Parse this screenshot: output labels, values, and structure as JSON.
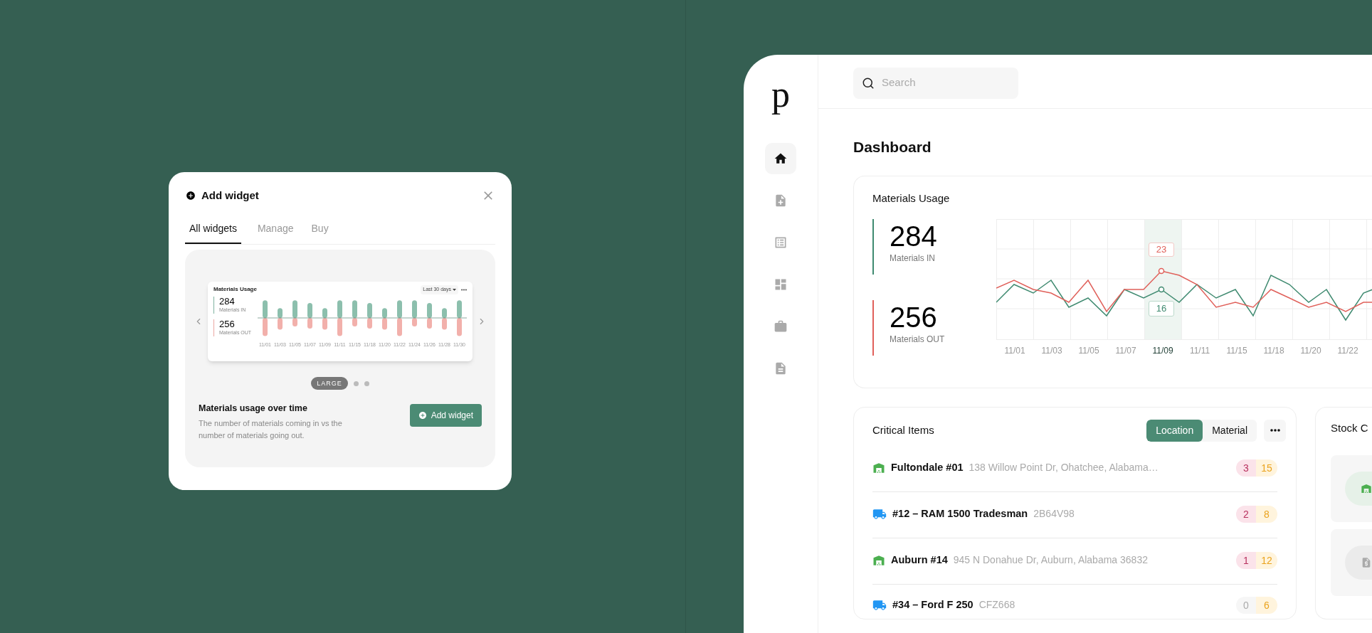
{
  "add_widget_dialog": {
    "title": "Add widget",
    "tabs": [
      {
        "label": "All widgets",
        "selected": true
      },
      {
        "label": "Manage",
        "selected": false
      },
      {
        "label": "Buy",
        "selected": false
      }
    ],
    "preview": {
      "title": "Materials Usage",
      "range": "Last 30 days",
      "stats": [
        {
          "value": "284",
          "label": "Materials IN",
          "color": "#7fb3a0"
        },
        {
          "value": "256",
          "label": "Materials OUT",
          "color": "#eaa7a2"
        }
      ],
      "x_labels": [
        "11/01",
        "11/03",
        "11/05",
        "11/07",
        "11/09",
        "11/11",
        "11/15",
        "11/18",
        "11/20",
        "11/22",
        "11/24",
        "11/26",
        "11/28",
        "11/30"
      ]
    },
    "sizes": [
      {
        "label": "LARGE",
        "selected": true
      },
      {
        "selected": false
      },
      {
        "selected": false
      }
    ],
    "widget_title": "Materials usage over time",
    "widget_description": "The number of materials coming in vs the number of materials going out.",
    "add_button": "Add widget"
  },
  "app": {
    "logo": "p",
    "sidebar": [
      {
        "selected": true
      },
      {
        "selected": false
      },
      {
        "selected": false
      },
      {
        "selected": false
      },
      {
        "selected": false
      },
      {
        "selected": false
      }
    ],
    "search": {
      "placeholder": "Search"
    },
    "page_title": "Dashboard",
    "materials_usage": {
      "title": "Materials Usage",
      "stats": [
        {
          "value": "284",
          "label": "Materials IN",
          "color": "#3f8a70"
        },
        {
          "value": "256",
          "label": "Materials OUT",
          "color": "#e0605a"
        }
      ],
      "x_labels": [
        {
          "label": "11/01",
          "selected": false
        },
        {
          "label": "11/03",
          "selected": false
        },
        {
          "label": "11/05",
          "selected": false
        },
        {
          "label": "11/07",
          "selected": false
        },
        {
          "label": "11/09",
          "selected": true
        },
        {
          "label": "11/11",
          "selected": false
        },
        {
          "label": "11/15",
          "selected": false
        },
        {
          "label": "11/18",
          "selected": false
        },
        {
          "label": "11/20",
          "selected": false
        },
        {
          "label": "11/22",
          "selected": false
        }
      ],
      "tooltip_out": "23",
      "tooltip_in": "16"
    },
    "critical_items": {
      "title": "Critical Items",
      "toggle": [
        {
          "label": "Location",
          "selected": true
        },
        {
          "label": "Material",
          "selected": false
        }
      ],
      "rows": [
        {
          "kind": "location",
          "name": "Fultondale #01",
          "detail": "138 Willow Point Dr, Ohatchee, Alabama…",
          "critical": "3",
          "critical_active": true,
          "low": "15"
        },
        {
          "kind": "vehicle",
          "name": "#12 – RAM 1500 Tradesman",
          "detail": "2B64V98",
          "critical": "2",
          "critical_active": true,
          "low": "8"
        },
        {
          "kind": "location",
          "name": "Auburn #14",
          "detail": "945 N Donahue Dr, Auburn, Alabama 36832",
          "critical": "1",
          "critical_active": true,
          "low": "12"
        },
        {
          "kind": "vehicle",
          "name": "#34 – Ford F 250",
          "detail": "CFZ668",
          "critical": "0",
          "critical_active": false,
          "low": "6"
        }
      ]
    },
    "stock_card": {
      "title": "Stock C",
      "tiles": [
        {
          "kind": "location"
        },
        {
          "kind": "invoice"
        }
      ]
    }
  }
}
